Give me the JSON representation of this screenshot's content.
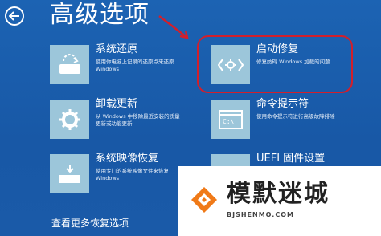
{
  "header": {
    "title": "高级选项",
    "back_icon": "back-arrow-icon"
  },
  "options": [
    {
      "title": "系统还原",
      "desc": "使用你电脑上记录的还原点来还原 Windows",
      "icon": "system-restore-icon"
    },
    {
      "title": "启动修复",
      "desc": "修复妨碍 Windows 加载的问题",
      "icon": "startup-repair-icon"
    },
    {
      "title": "卸载更新",
      "desc": "从 Windows 中移除最近安装的质量更新或功能更新",
      "icon": "gear-icon"
    },
    {
      "title": "命令提示符",
      "desc": "使用命令提示符进行高级故障排除",
      "icon": "command-prompt-icon"
    },
    {
      "title": "系统映像恢复",
      "desc": "使用专门的系统映像文件来恢复 Windows",
      "icon": "system-image-icon"
    },
    {
      "title": "UEFI 固件设置",
      "desc": "",
      "icon": "uefi-icon"
    }
  ],
  "footer": {
    "more_link": "查看更多恢复选项"
  },
  "watermark": {
    "title": "模默迷城",
    "url": "BJSHENMO.COM"
  },
  "colors": {
    "background": "#1a5dab",
    "tile_icon": "#9cc6da",
    "highlight": "#d21f2b"
  }
}
